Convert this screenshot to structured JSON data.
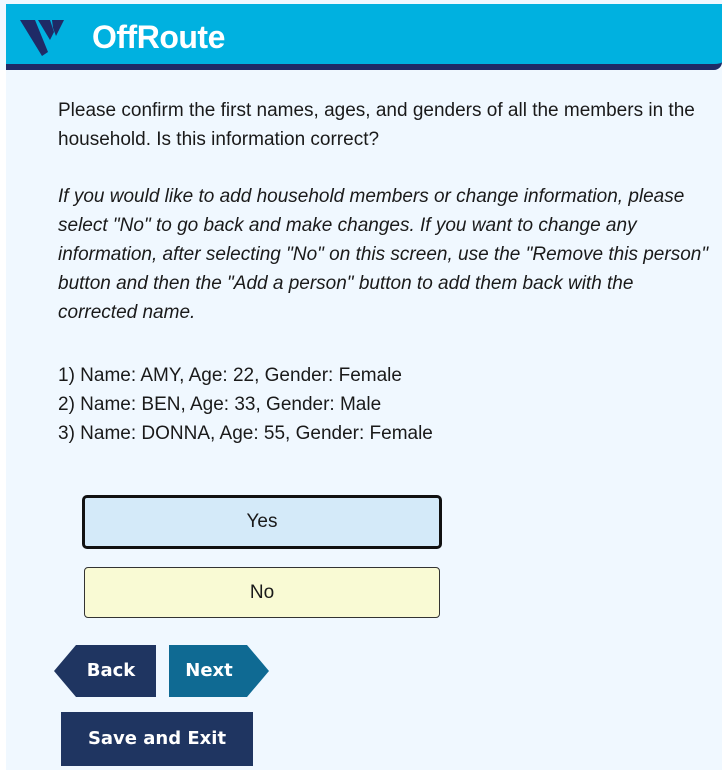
{
  "header": {
    "brand": "OffRoute",
    "logo_icon": "offroute-logo-icon",
    "colors": {
      "bar": "#00b1e0",
      "underline": "#1f2a66"
    }
  },
  "question": "Please confirm the first names, ages, and genders of all the members in the household. Is this information correct?",
  "instructions": "If you would like to add household members or change information, please select \"No\" to go back and make changes. If you want to change any information, after selecting \"No\" on this screen, use the \"Remove this person\" button and then the \"Add a person\" button to add them back with the corrected name.",
  "members": [
    "1) Name: AMY, Age: 22, Gender: Female",
    "2) Name: BEN, Age: 33, Gender: Male",
    "3) Name: DONNA, Age: 55, Gender: Female"
  ],
  "choices": {
    "yes": "Yes",
    "no": "No",
    "selected": "Yes"
  },
  "navigation": {
    "back": "Back",
    "next": "Next",
    "save_exit": "Save and Exit",
    "colors": {
      "back": "#1f3561",
      "next": "#0f6a93"
    }
  }
}
